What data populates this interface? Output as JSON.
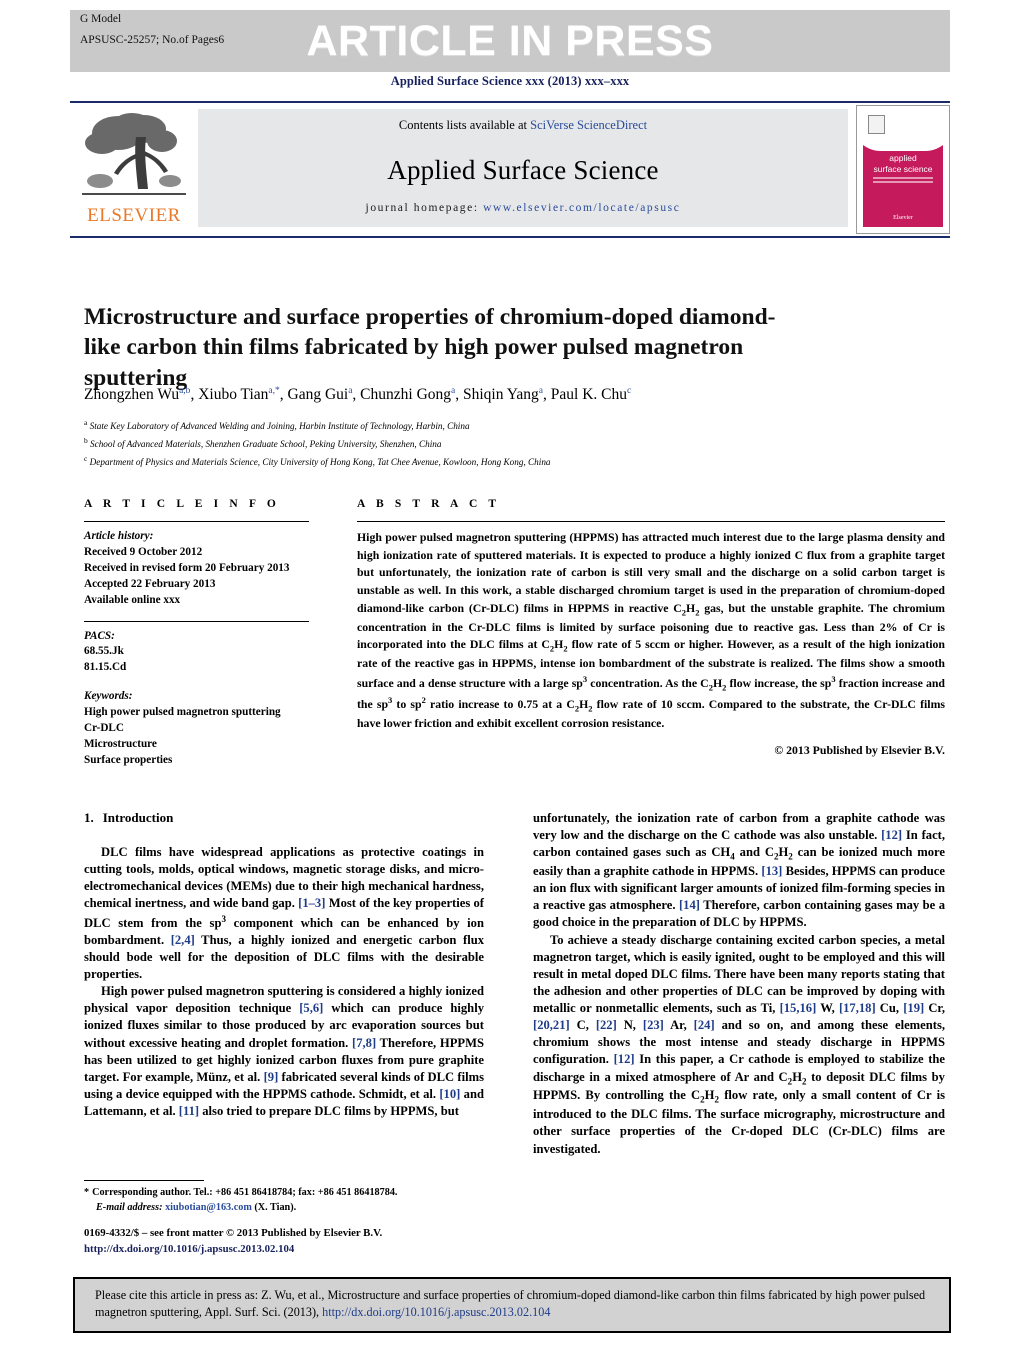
{
  "banner": {
    "g_model": "G Model",
    "article_id": "APSUSC-25257;   No.of Pages6",
    "article_in_press": "ARTICLE IN PRESS",
    "journal_ref": "Applied Surface Science xxx (2013) xxx–xxx"
  },
  "masthead": {
    "contents_prefix": "Contents lists available at ",
    "contents_link": "SciVerse ScienceDirect",
    "journal_name": "Applied Surface Science",
    "homepage_label": "journal homepage: ",
    "homepage_url": "www.elsevier.com/locate/apsusc",
    "publisher": "ELSEVIER",
    "cover_title_line1": "applied",
    "cover_title_line2": "surface science",
    "cover_publisher": "Elsevier"
  },
  "article": {
    "title": "Microstructure and surface properties of chromium-doped diamond-like carbon thin films fabricated by high power pulsed magnetron sputtering",
    "authors_html": "Zhongzhen Wu<sup>a,b</sup>, Xiubo Tian<sup>a,</sup><sup>*</sup>, Gang Gui<sup>a</sup>, Chunzhi Gong<sup>a</sup>, Shiqin Yang<sup>a</sup>, Paul K. Chu<sup>c</sup>",
    "affiliations": [
      {
        "mark": "a",
        "text": "State Key Laboratory of Advanced Welding and Joining, Harbin Institute of Technology, Harbin, China"
      },
      {
        "mark": "b",
        "text": "School of Advanced Materials, Shenzhen Graduate School, Peking University, Shenzhen, China"
      },
      {
        "mark": "c",
        "text": "Department of Physics and Materials Science, City University of Hong Kong, Tat Chee Avenue, Kowloon, Hong Kong, China"
      }
    ]
  },
  "article_info": {
    "heading": "A R T I C L E    I N F O",
    "history_label": "Article history:",
    "history": [
      "Received 9 October 2012",
      "Received in revised form 20 February 2013",
      "Accepted 22 February 2013",
      "Available online xxx"
    ],
    "pacs_label": "PACS:",
    "pacs": [
      "68.55.Jk",
      "81.15.Cd"
    ],
    "keywords_label": "Keywords:",
    "keywords": [
      "High power pulsed magnetron sputtering",
      "Cr-DLC",
      "Microstructure",
      "Surface properties"
    ]
  },
  "abstract": {
    "heading": "A B S T R A C T",
    "text_html": "High power pulsed magnetron sputtering (HPPMS) has attracted much interest due to the large plasma density and high ionization rate of sputtered materials. It is expected to produce a highly ionized C flux from a graphite target but unfortunately, the ionization rate of carbon is still very small and the discharge on a solid carbon target is unstable as well. In this work, a stable discharged chromium target is used in the preparation of chromium-doped diamond-like carbon (Cr-DLC) films in HPPMS in reactive C<sub>2</sub>H<sub>2</sub> gas, but the unstable graphite. The chromium concentration in the Cr-DLC films is limited by surface poisoning due to reactive gas. Less than 2% of Cr is incorporated into the DLC films at C<sub>2</sub>H<sub>2</sub> flow rate of 5 sccm or higher. However, as a result of the high ionization rate of the reactive gas in HPPMS, intense ion bombardment of the substrate is realized. The films show a smooth surface and a dense structure with a large sp<sup>3</sup> concentration. As the C<sub>2</sub>H<sub>2</sub> flow increase, the sp<sup>3</sup> fraction increase and the sp<sup>3</sup> to sp<sup>2</sup> ratio increase to 0.75 at a C<sub>2</sub>H<sub>2</sub> flow rate of 10 sccm. Compared to the substrate, the Cr-DLC films have lower friction and exhibit excellent corrosion resistance.",
    "copyright": "© 2013 Published by Elsevier B.V."
  },
  "body": {
    "section_number": "1.",
    "section_title": "Introduction",
    "left_paragraphs_html": [
      "DLC films have widespread applications as protective coatings in cutting tools, molds, optical windows, magnetic storage disks, and micro-electromechanical devices (MEMs) due to their high mechanical hardness, chemical inertness, and wide band gap. <span class=\"ref\">[1–3]</span> Most of the key properties of DLC stem from the sp<sup>3</sup> component which can be enhanced by ion bombardment. <span class=\"ref\">[2,4]</span> Thus, a highly ionized and energetic carbon flux should bode well for the deposition of DLC films with the desirable properties.",
      "High power pulsed magnetron sputtering is considered a highly ionized physical vapor deposition technique <span class=\"ref\">[5,6]</span> which can produce highly ionized fluxes similar to those produced by arc evaporation sources but without excessive heating and droplet formation. <span class=\"ref\">[7,8]</span> Therefore, HPPMS has been utilized to get highly ionized carbon fluxes from pure graphite target. For example, Münz, et al. <span class=\"ref\">[9]</span> fabricated several kinds of DLC films using a device equipped with the HPPMS cathode. Schmidt, et al. <span class=\"ref\">[10]</span> and Lattemann, et al. <span class=\"ref\">[11]</span> also tried to prepare DLC films by HPPMS, but"
    ],
    "right_paragraphs_html": [
      "unfortunately, the ionization rate of carbon from a graphite cathode was very low and the discharge on the C cathode was also unstable. <span class=\"ref\">[12]</span> In fact, carbon contained gases such as CH<sub>4</sub> and C<sub>2</sub>H<sub>2</sub> can be ionized much more easily than a graphite cathode in HPPMS. <span class=\"ref\">[13]</span> Besides, HPPMS can produce an ion flux with significant larger amounts of ionized film-forming species in a reactive gas atmosphere. <span class=\"ref\">[14]</span> Therefore, carbon containing gases may be a good choice in the preparation of DLC by HPPMS.",
      "To achieve a steady discharge containing excited carbon species, a metal magnetron target, which is easily ignited, ought to be employed and this will result in metal doped DLC films. There have been many reports stating that the adhesion and other properties of DLC can be improved by doping with metallic or nonmetallic elements, such as Ti, <span class=\"ref\">[15,16]</span> W, <span class=\"ref\">[17,18]</span> Cu, <span class=\"ref\">[19]</span> Cr, <span class=\"ref\">[20,21]</span> C, <span class=\"ref\">[22]</span> N, <span class=\"ref\">[23]</span> Ar, <span class=\"ref\">[24]</span> and so on, and among these elements, chromium shows the most intense and steady discharge in HPPMS configuration. <span class=\"ref\">[12]</span> In this paper, a Cr cathode is employed to stabilize the discharge in a mixed atmosphere of Ar and C<sub>2</sub>H<sub>2</sub> to deposit DLC films by HPPMS. By controlling the C<sub>2</sub>H<sub>2</sub> flow rate, only a small content of Cr is introduced to the DLC films. The surface micrography, microstructure and other surface properties of the Cr-doped DLC (Cr-DLC) films are investigated."
    ]
  },
  "footnote": {
    "star": "*",
    "corresponding": "Corresponding author. Tel.: +86 451 86418784; fax: +86 451 86418784.",
    "email_label": "E-mail address:",
    "email": "xiubotian@163.com",
    "email_owner": "(X. Tian)."
  },
  "frontmatter": {
    "issn_line": "0169-4332/$ – see front matter © 2013 Published by Elsevier B.V.",
    "doi": "http://dx.doi.org/10.1016/j.apsusc.2013.02.104"
  },
  "cite_box": {
    "text": "Please cite this article in press as: Z. Wu, et al., Microstructure and surface properties of chromium-doped diamond-like carbon thin films fabricated by high power pulsed magnetron sputtering, Appl. Surf. Sci. (2013), ",
    "doi": "http://dx.doi.org/10.1016/j.apsusc.2013.02.104"
  },
  "colors": {
    "banner_bg": "#c9c9c9",
    "rule_navy": "#1b2a6b",
    "link_blue": "#2a4b9b",
    "ref_blue": "#1f3c88",
    "elsevier_orange": "#e8792b",
    "cover_crimson": "#c51a5b",
    "contents_bg": "#e6e7e8",
    "cite_bg": "#d2d2d2"
  }
}
